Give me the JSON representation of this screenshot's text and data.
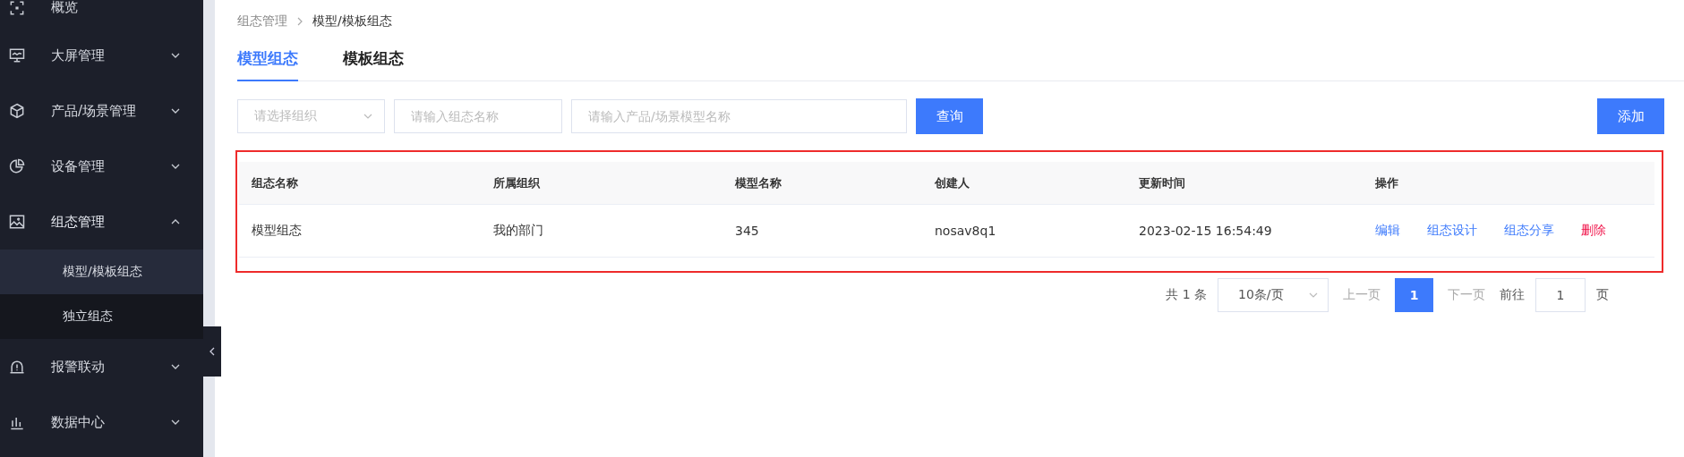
{
  "sidebar": {
    "items": [
      {
        "label": "概览"
      },
      {
        "label": "大屏管理",
        "expanded": false
      },
      {
        "label": "产品/场景管理",
        "expanded": false
      },
      {
        "label": "设备管理",
        "expanded": false
      },
      {
        "label": "组态管理",
        "expanded": true,
        "children": [
          {
            "label": "模型/模板组态",
            "selected": true
          },
          {
            "label": "独立组态",
            "selected": false
          }
        ]
      },
      {
        "label": "报警联动",
        "expanded": false
      },
      {
        "label": "数据中心",
        "expanded": false
      }
    ]
  },
  "breadcrumb": [
    "组态管理",
    "模型/模板组态"
  ],
  "tabs": [
    {
      "label": "模型组态",
      "selected": true
    },
    {
      "label": "模板组态",
      "selected": false
    }
  ],
  "filters": {
    "org_select": {
      "placeholder": "请选择组织"
    },
    "name_field": {
      "placeholder": "请输入组态名称"
    },
    "model_field": {
      "placeholder": "请输入产品/场景模型名称"
    },
    "query_button": "查询"
  },
  "add_button": "添加",
  "table": {
    "highlighted": true,
    "columns": [
      "组态名称",
      "所属组织",
      "模型名称",
      "创建人",
      "更新时间",
      "操作"
    ],
    "rows": [
      {
        "cells": [
          "模型组态",
          "我的部门",
          "345",
          "nosav8q1",
          "2023-02-15 16:54:49"
        ],
        "actions": [
          {
            "label": "编辑",
            "kind": "normal"
          },
          {
            "label": "组态设计",
            "kind": "normal"
          },
          {
            "label": "组态分享",
            "kind": "normal"
          },
          {
            "label": "删除",
            "kind": "danger"
          }
        ]
      }
    ]
  },
  "pagination": {
    "total": "共 1 条",
    "page_size": "10条/页",
    "prev": "上一页",
    "pages": [
      {
        "label": "1",
        "selected": true
      }
    ],
    "next": "下一页",
    "goto_label": "前往",
    "goto_value": "1",
    "goto_suffix": "页"
  }
}
